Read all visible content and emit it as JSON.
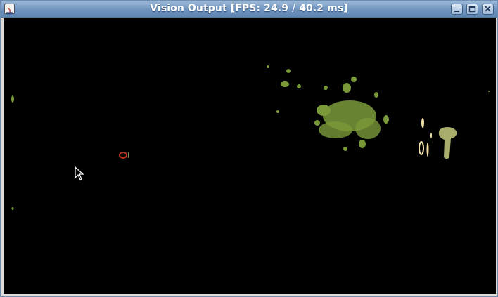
{
  "window": {
    "title": "Vision Output [FPS: 24.9 / 40.2 ms]",
    "controls": [
      "minimize-icon",
      "maximize-icon",
      "close-icon"
    ]
  },
  "canvas": {
    "background": "#000000",
    "blob_colors": {
      "green": "#7a9a3a",
      "khaki": "#a8ad6c",
      "red": "#c0301c",
      "cream": "#f3e0a8"
    }
  }
}
